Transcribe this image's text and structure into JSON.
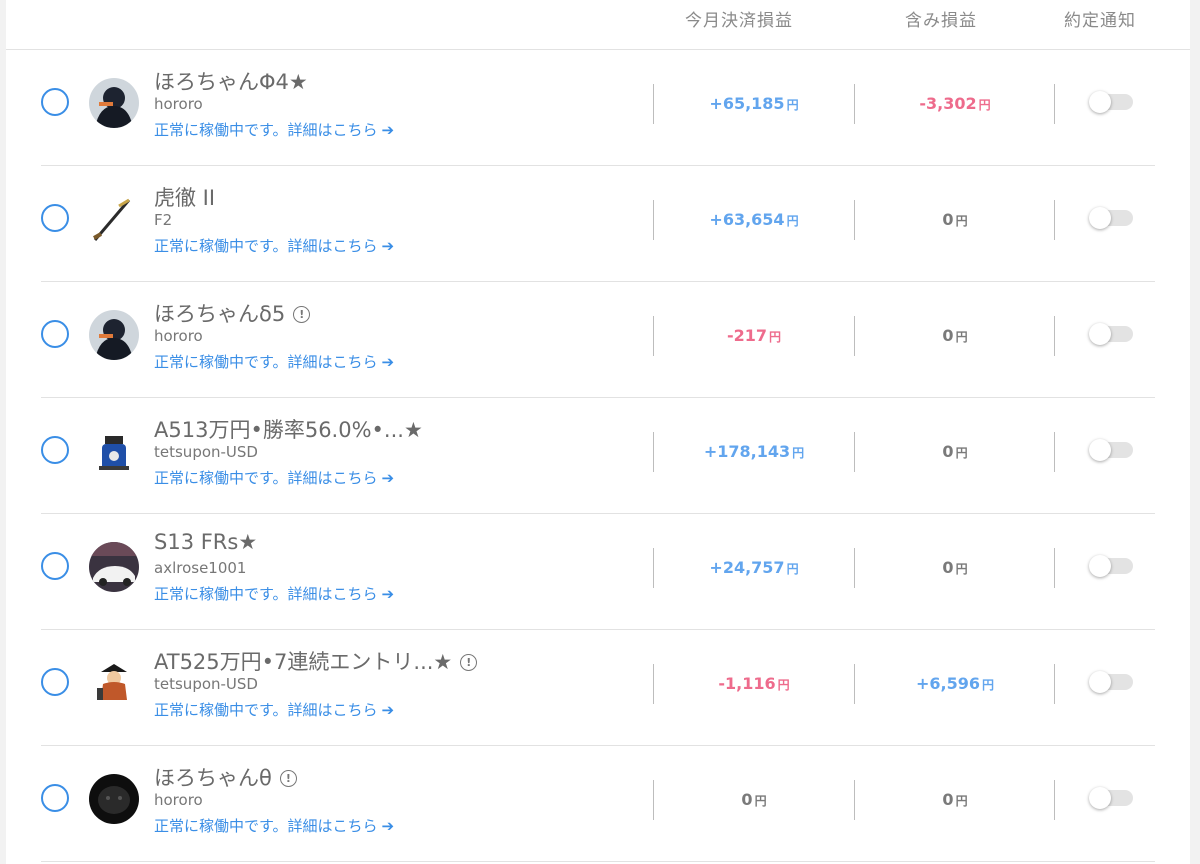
{
  "header": {
    "settled_pl": "今月決済損益",
    "unrealized_pl": "含み損益",
    "fill_notification": "約定通知"
  },
  "currency_unit": "円",
  "status_arrow": "➔",
  "rows": [
    {
      "name": "ほろちゃんΦ4★",
      "owner": "hororo",
      "status": "正常に稼働中です。詳細はこちら",
      "settled": "+65,185",
      "settled_sign": "positive",
      "unrealized": "-3,302",
      "unrealized_sign": "negative",
      "has_info": false,
      "notify_on": false
    },
    {
      "name": "虎徹 II",
      "owner": "F2",
      "status": "正常に稼働中です。詳細はこちら",
      "settled": "+63,654",
      "settled_sign": "positive",
      "unrealized": "0",
      "unrealized_sign": "zero",
      "has_info": false,
      "notify_on": false
    },
    {
      "name": "ほろちゃんδ5",
      "owner": "hororo",
      "status": "正常に稼働中です。詳細はこちら",
      "settled": "-217",
      "settled_sign": "negative",
      "unrealized": "0",
      "unrealized_sign": "zero",
      "has_info": true,
      "notify_on": false
    },
    {
      "name": "A513万円•勝率56.0%•...★",
      "owner": "tetsupon-USD",
      "status": "正常に稼働中です。詳細はこちら",
      "settled": "+178,143",
      "settled_sign": "positive",
      "unrealized": "0",
      "unrealized_sign": "zero",
      "has_info": false,
      "notify_on": false
    },
    {
      "name": "S13 FRs★",
      "owner": "axlrose1001",
      "status": "正常に稼働中です。詳細はこちら",
      "settled": "+24,757",
      "settled_sign": "positive",
      "unrealized": "0",
      "unrealized_sign": "zero",
      "has_info": false,
      "notify_on": false
    },
    {
      "name": "AT525万円•7連続エントリ...★",
      "owner": "tetsupon-USD",
      "status": "正常に稼働中です。詳細はこちら",
      "settled": "-1,116",
      "settled_sign": "negative",
      "unrealized": "+6,596",
      "unrealized_sign": "positive",
      "has_info": true,
      "notify_on": false
    },
    {
      "name": "ほろちゃんθ",
      "owner": "hororo",
      "status": "正常に稼働中です。詳細はこちら",
      "settled": "0",
      "settled_sign": "zero",
      "unrealized": "0",
      "unrealized_sign": "zero",
      "has_info": true,
      "notify_on": false
    }
  ],
  "colors": {
    "accent_blue": "#3a8ee6",
    "positive": "#62a5ee",
    "negative": "#ee6b8c",
    "zero": "#7a7a7a"
  },
  "avatars": [
    "dark-figure-photo",
    "katana-image",
    "dark-figure-photo",
    "character-figure",
    "white-car-photo",
    "pirate-character",
    "black-animal-photo"
  ]
}
